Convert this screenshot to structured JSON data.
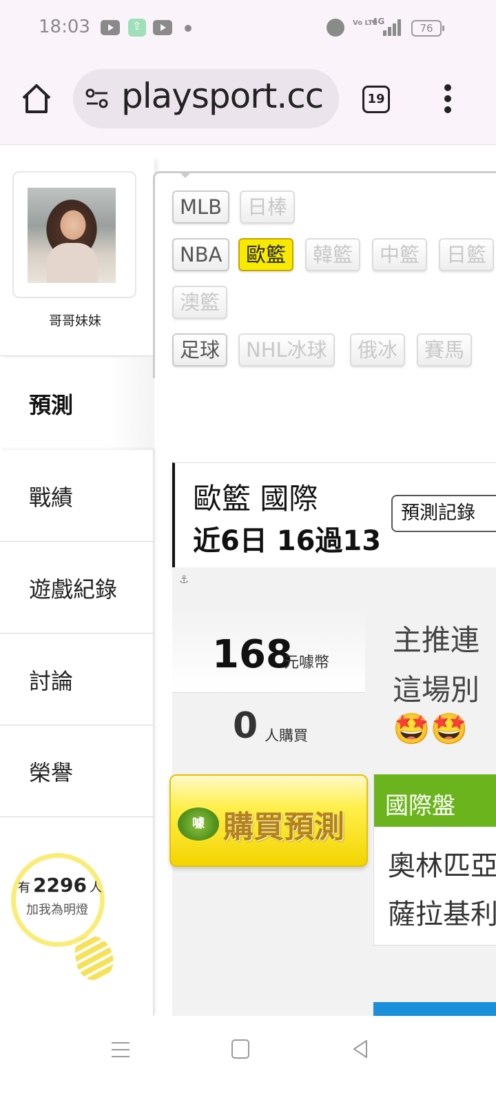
{
  "status_bar": {
    "time": "18:03",
    "battery": "76",
    "network": "4G",
    "volte": "Vo LTE"
  },
  "browser": {
    "url": "playsport.cc",
    "tab_count": "19"
  },
  "profile": {
    "name": "哥哥妹妹"
  },
  "left_nav": {
    "active": "預測",
    "items": [
      "戰績",
      "遊戲紀錄",
      "討論",
      "榮譽"
    ]
  },
  "fans": {
    "prefix": "有",
    "count": "2296",
    "suffix": "人",
    "caption": "加我為明燈"
  },
  "sports": {
    "row1": [
      {
        "label": "MLB",
        "state": "normal"
      },
      {
        "label": "日棒",
        "state": "dim"
      }
    ],
    "row2": [
      {
        "label": "NBA",
        "state": "normal"
      },
      {
        "label": "歐籃",
        "state": "active"
      },
      {
        "label": "韓籃",
        "state": "dim"
      },
      {
        "label": "中籃",
        "state": "dim"
      },
      {
        "label": "日籃",
        "state": "dim"
      }
    ],
    "row3": [
      {
        "label": "澳籃",
        "state": "dim"
      }
    ],
    "row4": [
      {
        "label": "足球",
        "state": "normal"
      },
      {
        "label": "NHL冰球",
        "state": "dim"
      },
      {
        "label": "俄冰",
        "state": "dim"
      },
      {
        "label": "賽馬",
        "state": "dim"
      }
    ]
  },
  "prediction": {
    "title": "歐籃 國際",
    "record": "近6日 16過13",
    "record_button": "預測記錄",
    "price": "168",
    "price_unit": "元噱幣",
    "buyers": "0",
    "buyers_unit": "人購買",
    "description_lines": [
      "主推連",
      "這場別"
    ],
    "emojis": "🤩🤩",
    "buy_badge": "噱",
    "buy_label": "購買預測",
    "market_label": "國際盤",
    "teams": [
      "奧林匹亞",
      "薩拉基利斯"
    ]
  },
  "colors": {
    "active_chip": "#f7ea00",
    "market_green": "#6cb41e",
    "bulb": "#f9ed79",
    "accent_blue": "#1a8fdc"
  }
}
